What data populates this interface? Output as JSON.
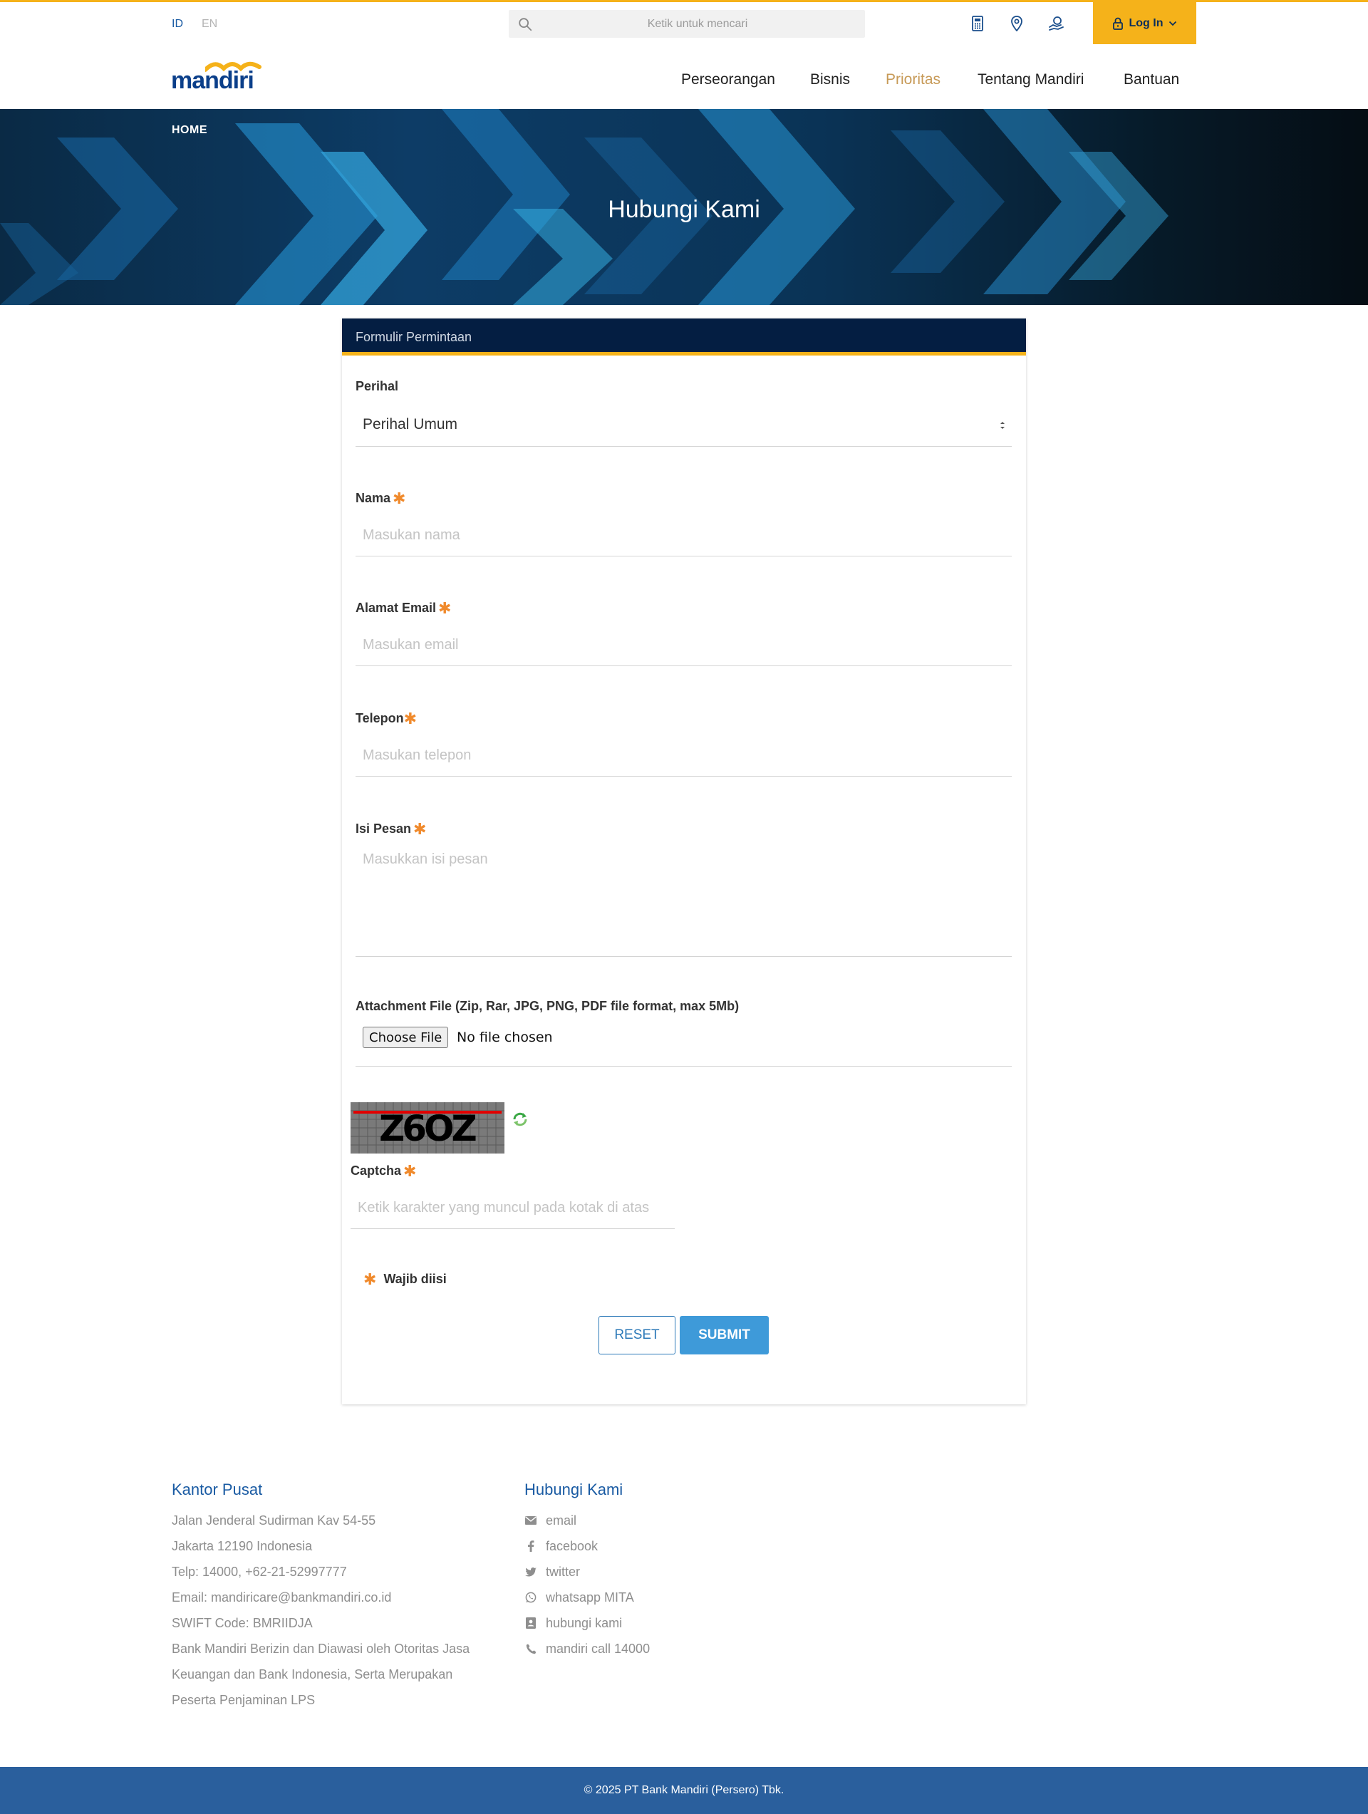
{
  "topbar": {
    "lang_id": "ID",
    "lang_en": "EN",
    "search_placeholder": "Ketik untuk mencari",
    "login_label": "Log In"
  },
  "logo": {
    "text": "mandiri"
  },
  "nav": {
    "items": [
      "Perseorangan",
      "Bisnis",
      "Prioritas",
      "Tentang Mandiri",
      "Bantuan"
    ],
    "active": "Prioritas"
  },
  "hero": {
    "breadcrumb": "HOME",
    "title": "Hubungi Kami"
  },
  "form": {
    "header": "Formulir Permintaan",
    "perihal_label": "Perihal",
    "perihal_value": "Perihal Umum",
    "nama_label": "Nama",
    "nama_placeholder": "Masukan nama",
    "email_label": "Alamat Email",
    "email_placeholder": "Masukan email",
    "telepon_label": "Telepon",
    "telepon_placeholder": "Masukan telepon",
    "pesan_label": "Isi Pesan",
    "pesan_placeholder": "Masukkan isi pesan",
    "attachment_label": "Attachment File (Zip, Rar, JPG, PNG, PDF file format, max 5Mb)",
    "file_button": "Choose File",
    "file_status": "No file chosen",
    "captcha_text": "Z6OZ",
    "captcha_label": "Captcha",
    "captcha_placeholder": "Ketik karakter yang muncul pada kotak di atas",
    "required_note": "Wajib diisi",
    "reset_label": "RESET",
    "submit_label": "SUBMIT",
    "required_mark": "✱"
  },
  "footer": {
    "office_title": "Kantor Pusat",
    "office_lines": [
      "Jalan Jenderal Sudirman Kav 54-55",
      "Jakarta 12190 Indonesia",
      "Telp: 14000, +62-21-52997777",
      "Email: mandiricare@bankmandiri.co.id",
      "SWIFT Code: BMRIIDJA",
      "Bank Mandiri Berizin dan Diawasi oleh Otoritas Jasa",
      "Keuangan dan Bank Indonesia, Serta Merupakan",
      "Peserta Penjaminan LPS"
    ],
    "contact_title": "Hubungi Kami",
    "contacts": [
      {
        "icon": "envelope-icon",
        "label": "email"
      },
      {
        "icon": "facebook-icon",
        "label": "facebook"
      },
      {
        "icon": "twitter-icon",
        "label": "twitter"
      },
      {
        "icon": "whatsapp-icon",
        "label": "whatsapp MITA"
      },
      {
        "icon": "contact-card-icon",
        "label": "hubungi kami"
      },
      {
        "icon": "phone-icon",
        "label": "mandiri call 14000"
      }
    ],
    "copyright": "© 2025 PT Bank Mandiri (Persero) Tbk."
  },
  "colors": {
    "accent_yellow": "#f5b21a",
    "brand_blue": "#0b3f8a",
    "header_navy": "#041e42",
    "submit_blue": "#3e9ad9",
    "footer_bar": "#2a5f9d",
    "required_orange": "#f08a2c",
    "nav_active": "#c79a57"
  }
}
